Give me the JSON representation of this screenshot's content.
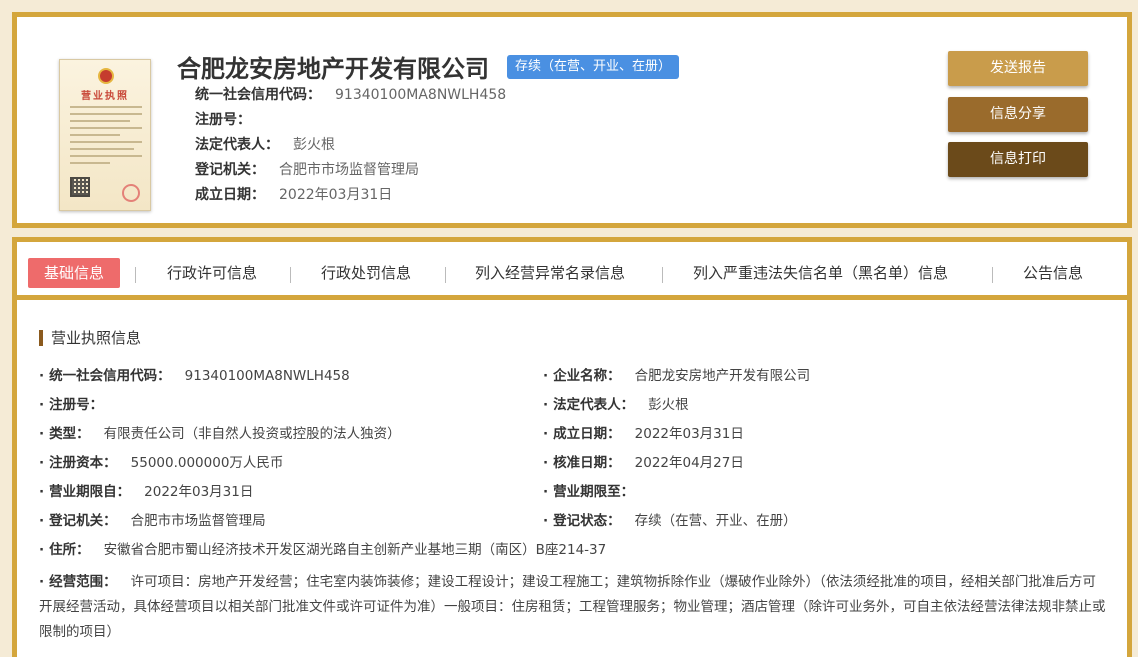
{
  "company": {
    "name": "合肥龙安房地产开发有限公司",
    "status": "存续（在营、开业、在册）",
    "license_title": "营业执照"
  },
  "top_info": [
    {
      "label": "统一社会信用代码：",
      "value": "91340100MA8NWLH458"
    },
    {
      "label": "注册号：",
      "value": ""
    },
    {
      "label": "法定代表人：",
      "value": "彭火根"
    },
    {
      "label": "登记机关：",
      "value": "合肥市市场监督管理局"
    },
    {
      "label": "成立日期：",
      "value": "2022年03月31日"
    }
  ],
  "actions": {
    "report": "发送报告",
    "share": "信息分享",
    "print": "信息打印"
  },
  "tabs": [
    "基础信息",
    "行政许可信息",
    "行政处罚信息",
    "列入经营异常名录信息",
    "列入严重违法失信名单（黑名单）信息",
    "公告信息"
  ],
  "section_title": "营业执照信息",
  "bullet": "·",
  "fields_left": [
    {
      "label": "统一社会信用代码：",
      "value": "91340100MA8NWLH458"
    },
    {
      "label": "注册号：",
      "value": ""
    },
    {
      "label": "类型：",
      "value": "有限责任公司（非自然人投资或控股的法人独资）"
    },
    {
      "label": "注册资本：",
      "value": "55000.000000万人民币"
    },
    {
      "label": "营业期限自：",
      "value": "2022年03月31日"
    },
    {
      "label": "登记机关：",
      "value": "合肥市市场监督管理局"
    },
    {
      "label": "住所：",
      "value": "安徽省合肥市蜀山经济技术开发区湖光路自主创新产业基地三期（南区）B座214-37"
    }
  ],
  "fields_right": [
    {
      "label": "企业名称：",
      "value": "合肥龙安房地产开发有限公司"
    },
    {
      "label": "法定代表人：",
      "value": "彭火根"
    },
    {
      "label": "成立日期：",
      "value": "2022年03月31日"
    },
    {
      "label": "核准日期：",
      "value": "2022年04月27日"
    },
    {
      "label": "营业期限至：",
      "value": ""
    },
    {
      "label": "登记状态：",
      "value": "存续（在营、开业、在册）"
    }
  ],
  "business_scope": {
    "label": "经营范围：",
    "value": "许可项目：房地产开发经营；住宅室内装饰装修；建设工程设计；建设工程施工；建筑物拆除作业（爆破作业除外）（依法须经批准的项目，经相关部门批准后方可开展经营活动，具体经营项目以相关部门批准文件或许可证件为准）一般项目：住房租赁；工程管理服务；物业管理；酒店管理（除许可业务外，可自主依法经营法律法规非禁止或限制的项目）"
  }
}
